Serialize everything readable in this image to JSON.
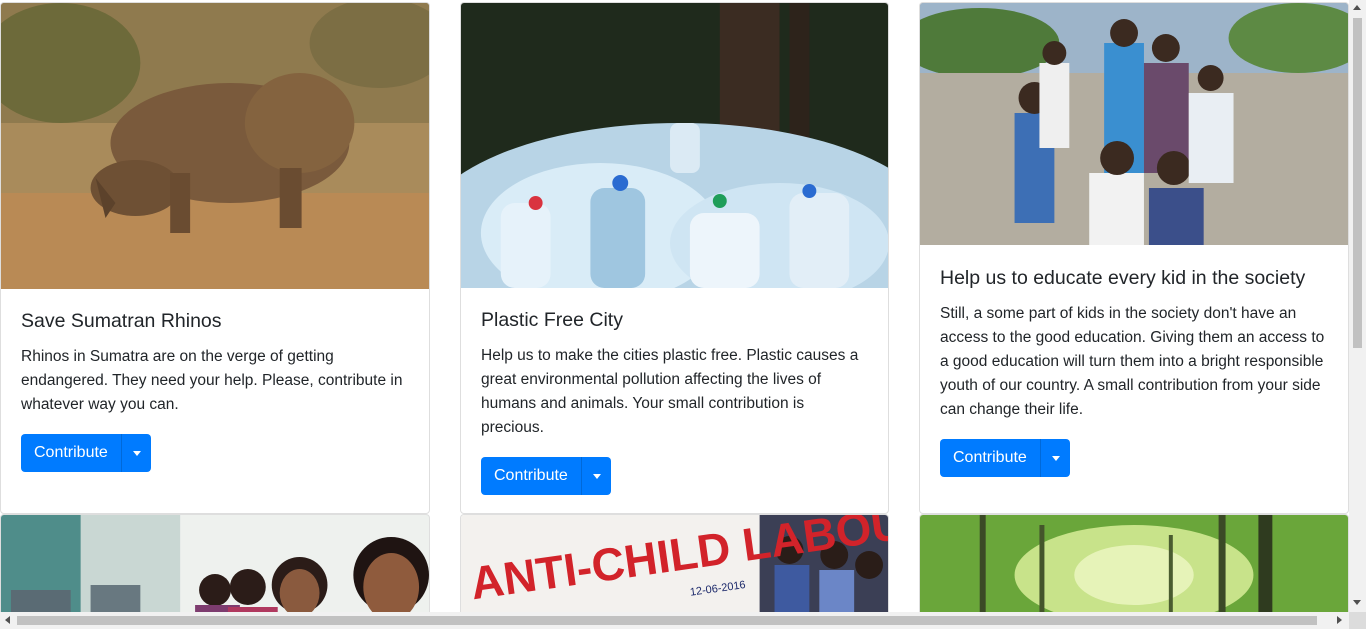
{
  "cards": [
    {
      "title": "Save Sumatran Rhinos",
      "text": "Rhinos in Sumatra are on the verge of getting endangered. They need your help. Please, contribute in whatever way you can.",
      "button_label": "Contribute",
      "image": "rhino-photo"
    },
    {
      "title": "Plastic Free City",
      "text": "Help us to make the cities plastic free. Plastic causes a great environmental pollution affecting the lives of humans and animals. Your small contribution is precious.",
      "button_label": "Contribute",
      "image": "plastic-bottles-photo"
    },
    {
      "title": "Help us to educate every kid in the society",
      "text": "Still, a some part of kids in the society don't have an access to the good education. Giving them an access to a good education will turn them into a bright responsible youth of our country. A small contribution from your side can change their life.",
      "button_label": "Contribute",
      "image": "village-kids-photo"
    }
  ],
  "second_row": [
    {
      "image": "women-at-computers-photo"
    },
    {
      "image": "anti-child-labour-banner-photo",
      "banner_text": "ANTI-CHILD LABOUR",
      "banner_date": "12-06-2016"
    },
    {
      "image": "forest-photo"
    }
  ],
  "colors": {
    "primary": "#007bff",
    "primary_border": "#0069d9"
  }
}
